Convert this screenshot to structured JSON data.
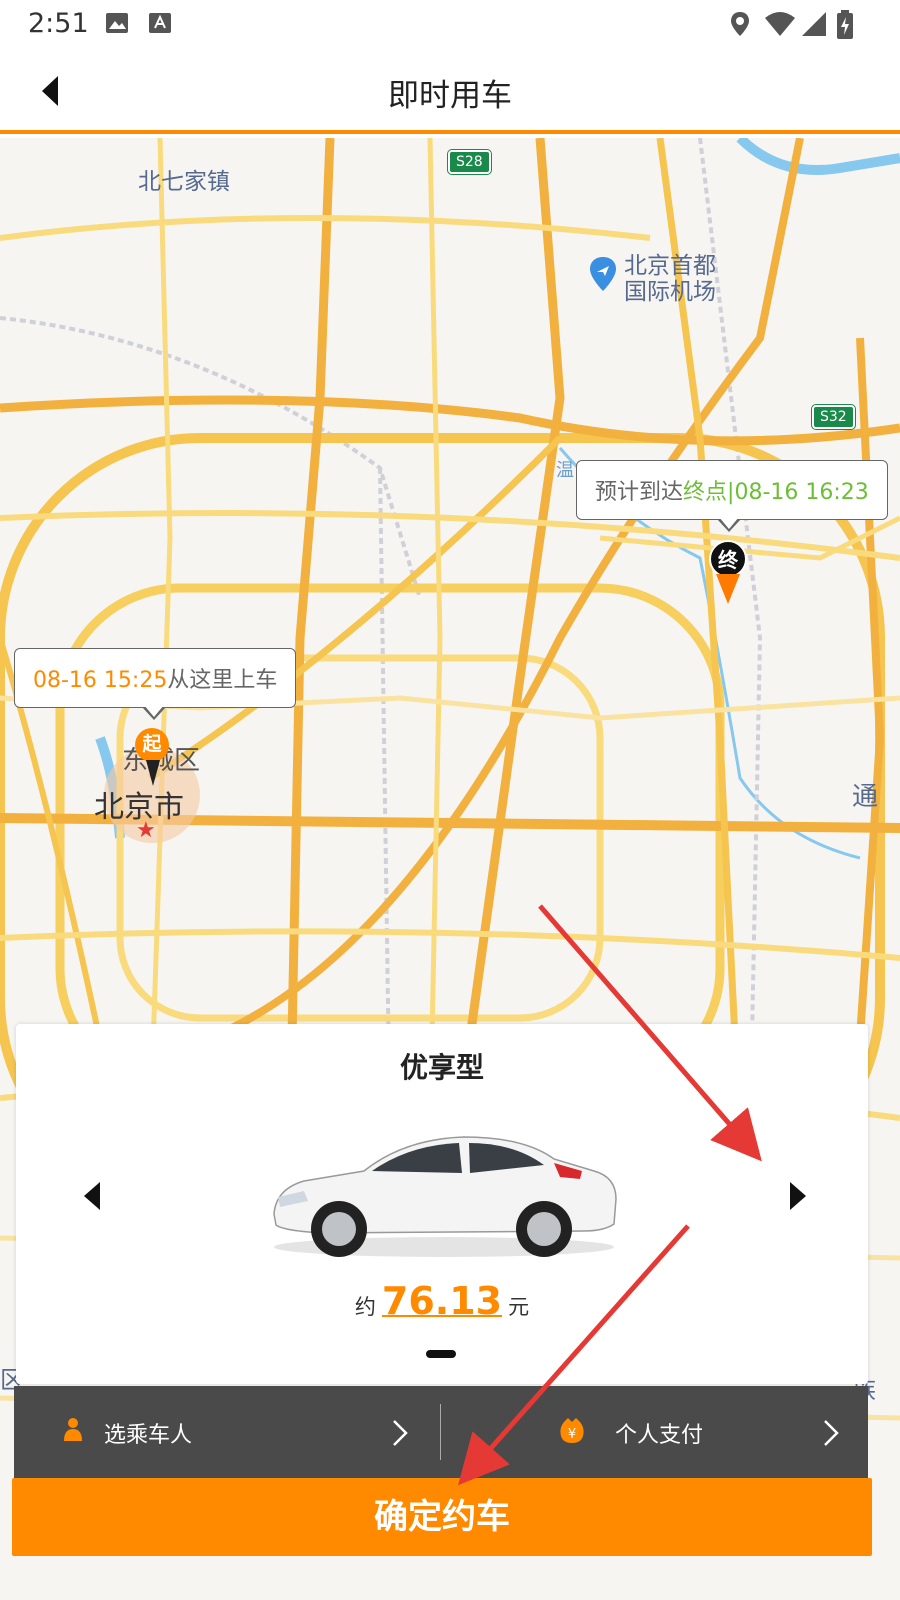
{
  "status_bar": {
    "time": "2:51",
    "icons": [
      "image-icon",
      "font-icon",
      "location-icon",
      "wifi-icon",
      "signal-icon",
      "battery-icon"
    ]
  },
  "header": {
    "back_icon": "back-arrow-icon",
    "title": "即时用车"
  },
  "map": {
    "labels": {
      "beiqijia": "北七家镇",
      "airport_line1": "北京首都",
      "airport_line2": "国际机场",
      "dongcheng": "东城区",
      "beijing": "北京市",
      "tong": "通",
      "left_edge": "区",
      "right_edge": "族",
      "river": "温"
    },
    "routes": {
      "s28": "S28",
      "s32": "S32"
    },
    "start_bubble": {
      "time": "08-16 15:25",
      "text": "从这里上车"
    },
    "start_pin": "起",
    "end_bubble": {
      "prefix": "预计到达",
      "highlight": "终点",
      "time": "|08-16 16:23"
    },
    "end_pin": "终"
  },
  "vehicle_card": {
    "type": "优享型",
    "price_prefix": "约",
    "price": "76.13",
    "price_suffix": "元",
    "prev_icon": "triangle-left-icon",
    "next_icon": "triangle-right-icon"
  },
  "options": {
    "passenger_label": "选乘车人",
    "payment_label": "个人支付"
  },
  "confirm_button": "确定约车",
  "colors": {
    "accent": "#ff8a00",
    "green": "#6cbf35",
    "dark_bar": "#4a4a4a",
    "annotation_arrow": "#e53935"
  }
}
